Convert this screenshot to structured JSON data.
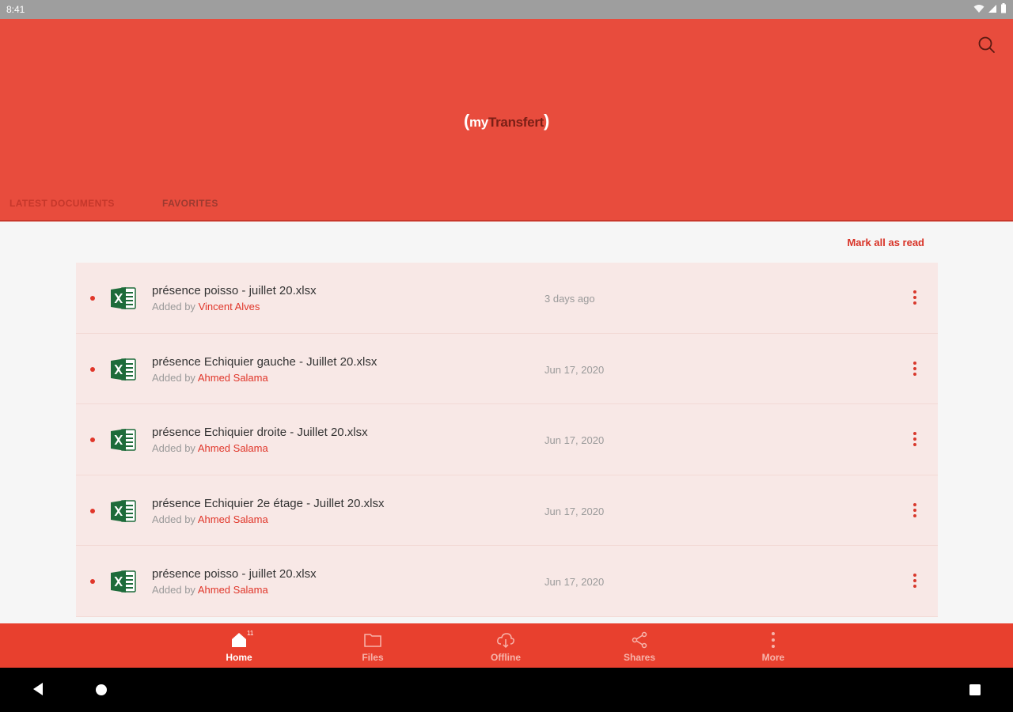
{
  "status_bar": {
    "time": "8:41"
  },
  "app": {
    "logo_my": "my",
    "logo_transfert": "Transfert",
    "logo_open": "(",
    "logo_close": ")"
  },
  "tabs": [
    {
      "label": "LATEST DOCUMENTS"
    },
    {
      "label": "FAVORITES"
    }
  ],
  "actions": {
    "mark_all_read": "Mark all as read"
  },
  "documents": [
    {
      "name": "présence poisso - juillet 20.xlsx",
      "added_prefix": "Added by",
      "author": "Vincent Alves",
      "date": "3 days ago"
    },
    {
      "name": "présence Echiquier gauche - Juillet 20.xlsx",
      "added_prefix": "Added by",
      "author": "Ahmed Salama",
      "date": "Jun 17, 2020"
    },
    {
      "name": "présence Echiquier droite - Juillet 20.xlsx",
      "added_prefix": "Added by",
      "author": "Ahmed Salama",
      "date": "Jun 17, 2020"
    },
    {
      "name": "présence Echiquier 2e étage - Juillet 20.xlsx",
      "added_prefix": "Added by",
      "author": "Ahmed Salama",
      "date": "Jun 17, 2020"
    },
    {
      "name": "présence poisso - juillet 20.xlsx",
      "added_prefix": "Added by",
      "author": "Ahmed Salama",
      "date": "Jun 17, 2020"
    }
  ],
  "bottom_nav": [
    {
      "label": "Home",
      "icon": "home-icon",
      "badge": "11"
    },
    {
      "label": "Files",
      "icon": "folder-icon"
    },
    {
      "label": "Offline",
      "icon": "cloud-download-icon"
    },
    {
      "label": "Shares",
      "icon": "share-icon"
    },
    {
      "label": "More",
      "icon": "more-vertical-icon"
    }
  ],
  "colors": {
    "brand": "#e84c3d",
    "accent": "#d8382c",
    "excel": "#1d6b3a"
  }
}
